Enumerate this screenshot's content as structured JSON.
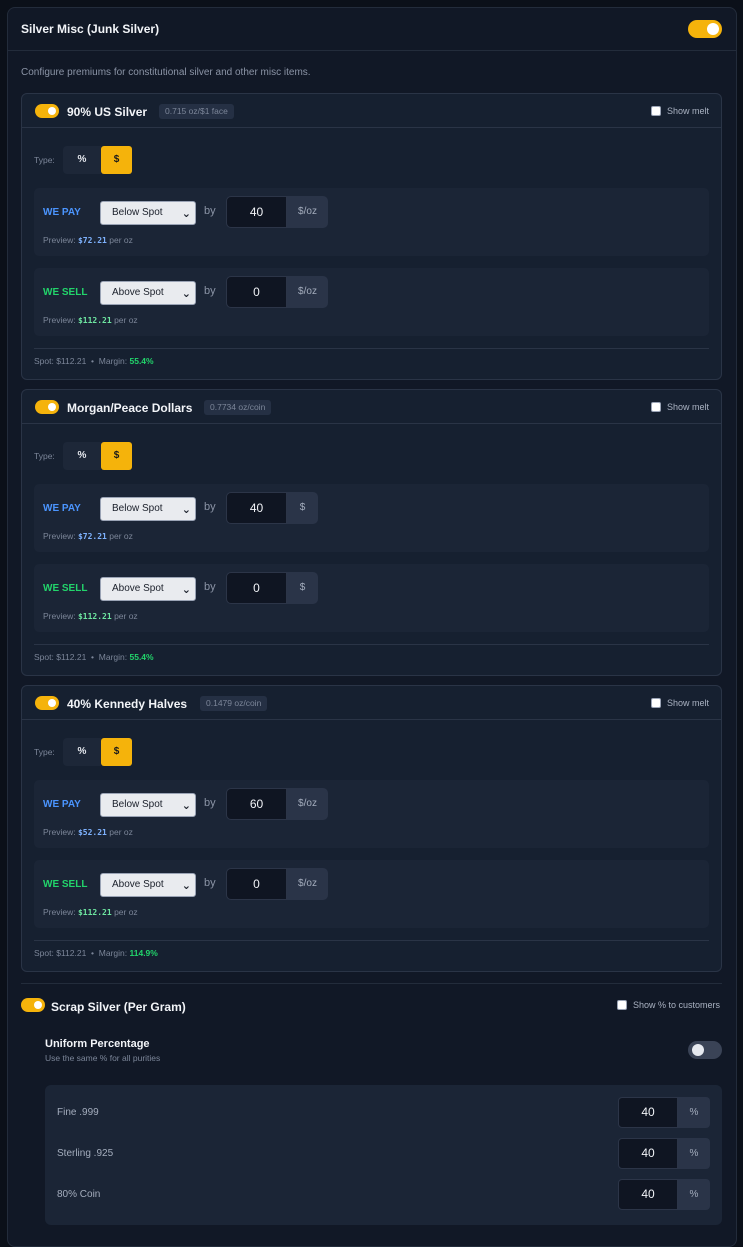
{
  "header": {
    "title": "Silver Misc (Junk Silver)",
    "enabled": true
  },
  "description": "Configure premiums for constitutional silver and other misc items.",
  "labels": {
    "show_melt": "Show melt",
    "type": "Type:",
    "type_pct": "%",
    "type_usd": "$",
    "we_pay": "WE PAY",
    "we_sell": "WE SELL",
    "by": "by",
    "preview": "Preview:",
    "per_oz": "per oz",
    "spot": "Spot: $112.21",
    "bullet": "•",
    "margin": "Margin:"
  },
  "items": [
    {
      "name": "90% US Silver",
      "badge": "0.715 oz/$1 face",
      "enabled": true,
      "pay": {
        "mode": "Below Spot",
        "value": "40",
        "unit": "$/oz",
        "preview": "$72.21"
      },
      "sell": {
        "mode": "Above Spot",
        "value": "0",
        "unit": "$/oz",
        "preview": "$112.21"
      },
      "margin": "55.4%"
    },
    {
      "name": "Morgan/Peace Dollars",
      "badge": "0.7734 oz/coin",
      "enabled": true,
      "pay": {
        "mode": "Below Spot",
        "value": "40",
        "unit": "$",
        "preview": "$72.21"
      },
      "sell": {
        "mode": "Above Spot",
        "value": "0",
        "unit": "$",
        "preview": "$112.21"
      },
      "margin": "55.4%"
    },
    {
      "name": "40% Kennedy Halves",
      "badge": "0.1479 oz/coin",
      "enabled": true,
      "pay": {
        "mode": "Below Spot",
        "value": "60",
        "unit": "$/oz",
        "preview": "$52.21"
      },
      "sell": {
        "mode": "Above Spot",
        "value": "0",
        "unit": "$/oz",
        "preview": "$112.21"
      },
      "margin": "114.9%"
    }
  ],
  "scrap": {
    "title": "Scrap Silver (Per Gram)",
    "enabled": true,
    "show_pct_label": "Show % to customers",
    "uniform_title": "Uniform Percentage",
    "uniform_sub": "Use the same % for all purities",
    "uniform_enabled": false,
    "purities": [
      {
        "label": "Fine .999",
        "value": "40",
        "unit": "%"
      },
      {
        "label": "Sterling .925",
        "value": "40",
        "unit": "%"
      },
      {
        "label": "80% Coin",
        "value": "40",
        "unit": "%"
      }
    ]
  }
}
